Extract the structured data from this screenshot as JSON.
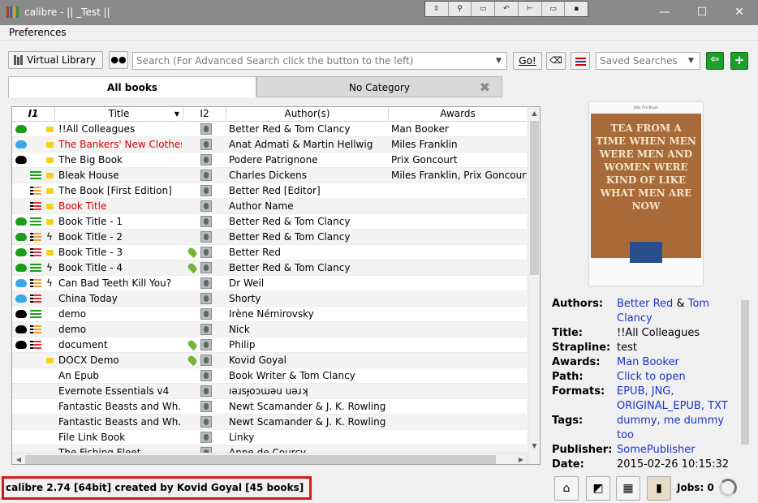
{
  "window": {
    "title": "calibre - || _Test ||",
    "minimize": "—",
    "maximize": "☐",
    "close": "✕",
    "float_toolbar": [
      "⇳",
      "⚲",
      "▭",
      "↶",
      "⊢",
      "▭",
      "▪"
    ]
  },
  "menu": {
    "preferences": "Preferences"
  },
  "toolbar": {
    "virtual_library": "Virtual Library",
    "search_placeholder": "Search (For Advanced Search click the button to the left)",
    "go": "Go!",
    "saved_searches_placeholder": "Saved Searches"
  },
  "tabs": {
    "all_books": "All books",
    "no_category": "No Category"
  },
  "table": {
    "headers": {
      "i1": "I1",
      "title": "Title",
      "i2": "I2",
      "authors": "Author(s)",
      "awards": "Awards"
    },
    "rows": [
      {
        "title": "!!All Colleagues",
        "authors": "Better Red & Tom Clancy",
        "awards": "Man Booker",
        "red": false,
        "cloud": "#1a9e1a",
        "list": "",
        "mark": "folder",
        "pin": false
      },
      {
        "title": "The Bankers' New Clothes",
        "authors": "Anat Admati & Martin Hellwig",
        "awards": "Miles Franklin",
        "red": true,
        "cloud": "#3aa8e8",
        "list": "",
        "mark": "folder",
        "pin": false
      },
      {
        "title": "The Big Book",
        "authors": "Podere Patrignone",
        "awards": "Prix Goncourt",
        "red": false,
        "cloud": "#000000",
        "list": "",
        "mark": "folder",
        "pin": false
      },
      {
        "title": "Bleak House",
        "authors": "Charles Dickens",
        "awards": "Miles Franklin, Prix Goncourt",
        "red": false,
        "cloud": "",
        "list": "g",
        "mark": "folder",
        "pin": false
      },
      {
        "title": "The Book [First Edition]",
        "authors": "Better Red [Editor]",
        "awards": "",
        "red": false,
        "cloud": "",
        "list": "o",
        "mark": "folder",
        "pin": false
      },
      {
        "title": "Book Title",
        "authors": "Author Name",
        "awards": "",
        "red": true,
        "cloud": "",
        "list": "r",
        "mark": "folder",
        "pin": false
      },
      {
        "title": "Book Title -  1",
        "authors": "Better Red & Tom Clancy",
        "awards": "",
        "red": false,
        "cloud": "#1a9e1a",
        "list": "g",
        "mark": "folder",
        "pin": false
      },
      {
        "title": "Book Title -  2",
        "authors": "Better Red & Tom Clancy",
        "awards": "",
        "red": false,
        "cloud": "#1a9e1a",
        "list": "o",
        "mark": "bolt",
        "pin": false
      },
      {
        "title": "Book Title -  3",
        "authors": "Better Red",
        "awards": "",
        "red": false,
        "cloud": "#1a9e1a",
        "list": "r",
        "mark": "folder",
        "pin": true
      },
      {
        "title": "Book Title -  4",
        "authors": "Better Red & Tom Clancy",
        "awards": "",
        "red": false,
        "cloud": "#1a9e1a",
        "list": "g",
        "mark": "bolt",
        "pin": true
      },
      {
        "title": "Can Bad Teeth Kill You?",
        "authors": "Dr Weil",
        "awards": "",
        "red": false,
        "cloud": "#3aa8e8",
        "list": "o",
        "mark": "bolt",
        "pin": false
      },
      {
        "title": "China Today",
        "authors": "Shorty",
        "awards": "",
        "red": false,
        "cloud": "#3aa8e8",
        "list": "r",
        "mark": "",
        "pin": false
      },
      {
        "title": "demo",
        "authors": "Irène Némirovsky",
        "awards": "",
        "red": false,
        "cloud": "#000000",
        "list": "g",
        "mark": "",
        "pin": false
      },
      {
        "title": "demo",
        "authors": "Nick",
        "awards": "",
        "red": false,
        "cloud": "#000000",
        "list": "o",
        "mark": "",
        "pin": false
      },
      {
        "title": "document",
        "authors": "Philip",
        "awards": "",
        "red": false,
        "cloud": "#000000",
        "list": "r",
        "mark": "",
        "pin": true
      },
      {
        "title": "DOCX Demo",
        "authors": "Kovid Goyal",
        "awards": "",
        "red": false,
        "cloud": "",
        "list": "",
        "mark": "folder",
        "pin": true
      },
      {
        "title": "An Epub",
        "authors": "Book Writer & Tom Clancy",
        "awards": "",
        "red": false,
        "cloud": "",
        "list": "",
        "mark": "",
        "pin": false
      },
      {
        "title": "Evernote Essentials v4",
        "authors": "ıəɹsɟoɔɯəu uəɹʞ",
        "awards": "",
        "red": false,
        "cloud": "",
        "list": "",
        "mark": "",
        "pin": false
      },
      {
        "title": "Fantastic Beasts and Wh...",
        "authors": "Newt Scamander & J. K. Rowling",
        "awards": "",
        "red": false,
        "cloud": "",
        "list": "",
        "mark": "",
        "pin": false
      },
      {
        "title": "Fantastic Beasts and Wh...",
        "authors": "Newt Scamander & J. K. Rowling",
        "awards": "",
        "red": false,
        "cloud": "",
        "list": "",
        "mark": "",
        "pin": false
      },
      {
        "title": "File Link Book",
        "authors": "Linky",
        "awards": "",
        "red": false,
        "cloud": "",
        "list": "",
        "mark": "",
        "pin": false
      },
      {
        "title": "The Fishing Fleet",
        "authors": "Anne de Courcy",
        "awards": "",
        "red": false,
        "cloud": "",
        "list": "",
        "mark": "",
        "pin": false
      }
    ]
  },
  "cover": {
    "author_line": "Billy Tim Brush",
    "title_text": "TEA FROM A TIME WHEN MEN WERE MEN AND WOMEN WERE KIND OF LIKE WHAT MEN ARE NOW"
  },
  "details": {
    "authors_label": "Authors:",
    "author1": "Better Red",
    "amp": "&",
    "author2": "Tom Clancy",
    "title_label": "Title:",
    "title": "!!All Colleagues",
    "strapline_label": "Strapline:",
    "strapline": "test",
    "awards_label": "Awards:",
    "awards": "Man Booker",
    "path_label": "Path:",
    "path": "Click to open",
    "formats_label": "Formats:",
    "formats": "EPUB, JNG, ORIGINAL_EPUB, TXT",
    "tags_label": "Tags:",
    "tags": "dummy, me dummy too",
    "publisher_label": "Publisher:",
    "publisher": "SomePublisher",
    "date_label": "Date:",
    "date": "2015-02-26 10:15:32"
  },
  "status": {
    "message": "calibre 2.74 [64bit] created by Kovid Goyal    [45 books]",
    "jobs": "Jobs: 0"
  }
}
